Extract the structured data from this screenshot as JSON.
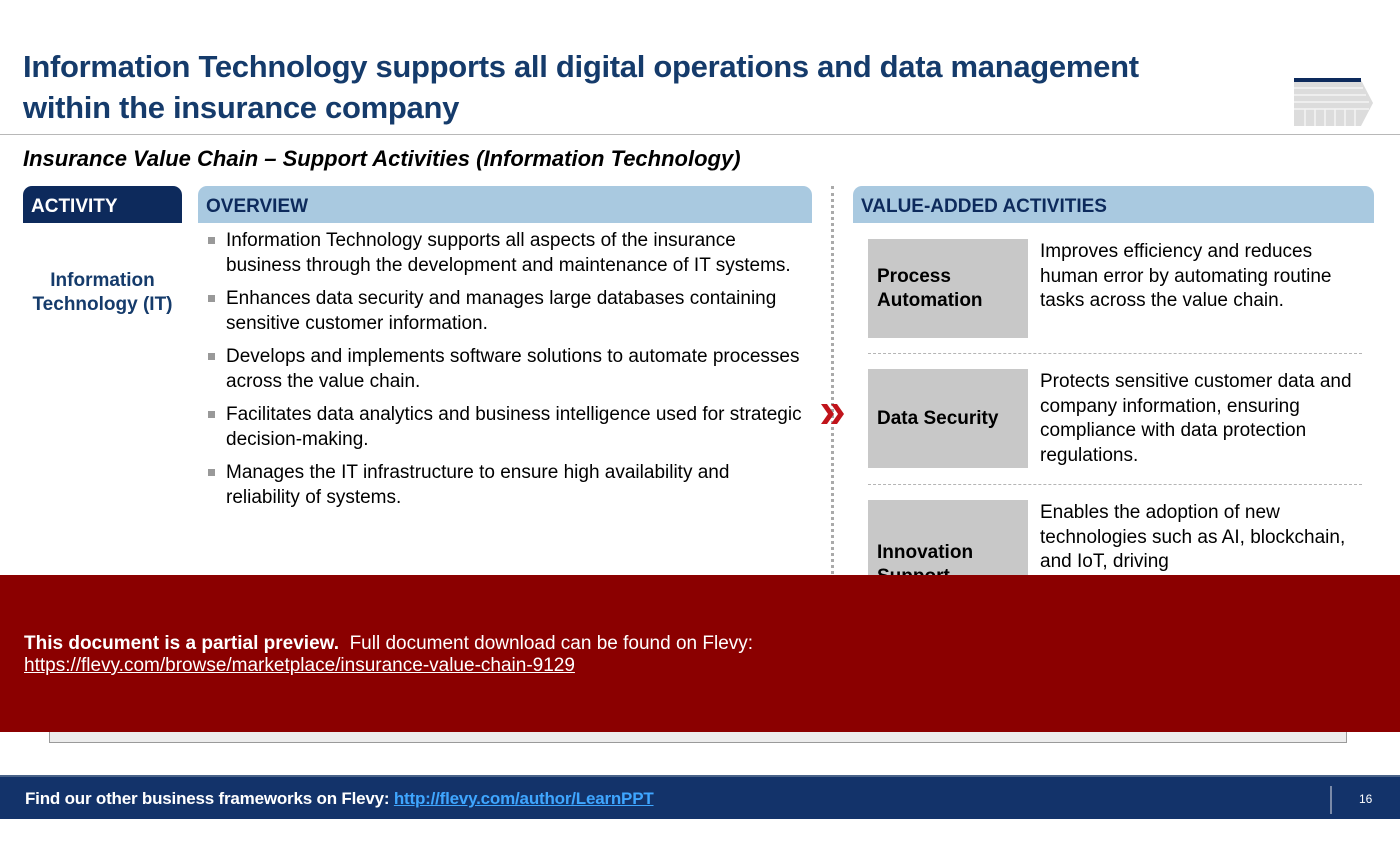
{
  "header": {
    "title": "Information Technology supports all digital operations and data management within the insurance company",
    "subtitle": "Insurance Value Chain – Support Activities (Information Technology)",
    "icon": "value-chain-icon"
  },
  "columns": {
    "activity_header": "ACTIVITY",
    "overview_header": "OVERVIEW",
    "value_added_header": "VALUE-ADDED ACTIVITIES"
  },
  "activity": {
    "name": "Information Technology (IT)"
  },
  "overview": {
    "bullets": [
      "Information Technology supports all aspects of the insurance business through the development and maintenance of IT systems.",
      "Enhances data security and manages large databases containing sensitive customer information.",
      "Develops and implements software solutions to automate processes across the value chain.",
      "Facilitates data analytics and business intelligence used for strategic decision-making.",
      "Manages the IT infrastructure to ensure high availability and reliability of systems."
    ]
  },
  "value_added": [
    {
      "label": "Process Automation",
      "description": "Improves efficiency and reduces human error by automating routine tasks across the value chain."
    },
    {
      "label": "Data Security",
      "description": "Protects sensitive customer data and company information, ensuring compliance with data protection regulations."
    },
    {
      "label": "Innovation Support",
      "description": "Enables the adoption of new technologies such as AI, blockchain, and IoT, driving"
    }
  ],
  "preview": {
    "bold_text": "This document is a partial preview.",
    "text": "Full document download can be found on Flevy:",
    "link": "https://flevy.com/browse/marketplace/insurance-value-chain-9129",
    "color": "#8b0000"
  },
  "footer": {
    "text": "Find our other business frameworks on Flevy:",
    "link": "http://flevy.com/author/LearnPPT",
    "page_number": "16"
  },
  "colors": {
    "navy": "#0d2a5c",
    "light_blue": "#a9c9e0",
    "title_blue": "#153b6b",
    "footer_bg": "#13336a",
    "chevron_red": "#c0141b"
  }
}
